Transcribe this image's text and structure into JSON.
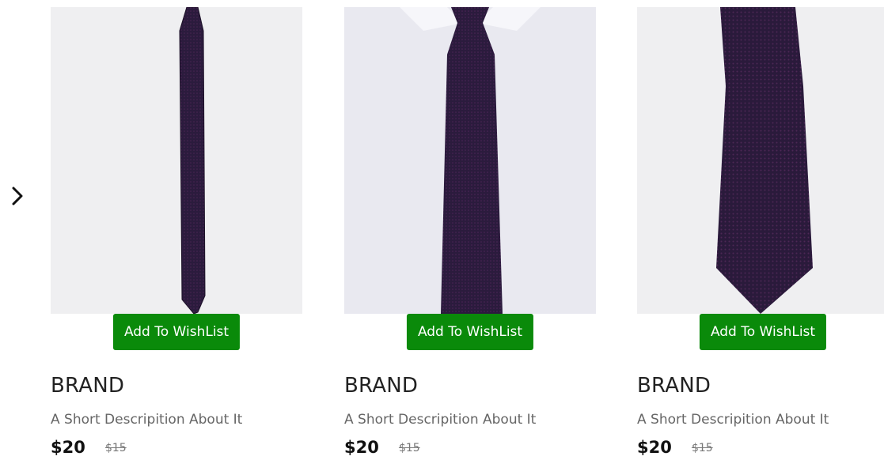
{
  "carousel": {
    "next_icon": "chevron-right-icon"
  },
  "products": [
    {
      "brand": "BRAND",
      "description": "A Short Descripition About It",
      "price": "$20",
      "old_price": "$15",
      "wishlist_label": "Add To WishList",
      "image_bg": "#efeff1",
      "tie_color": "#2b1b3d"
    },
    {
      "brand": "BRAND",
      "description": "A Short Descripition About It",
      "price": "$20",
      "old_price": "$15",
      "wishlist_label": "Add To WishList",
      "image_bg": "#e7e7ee",
      "tie_color": "#2b1b3d"
    },
    {
      "brand": "BRAND",
      "description": "A Short Descripition About It",
      "price": "$20",
      "old_price": "$15",
      "wishlist_label": "Add To WishList",
      "image_bg": "#efeff1",
      "tie_color": "#2b1b3d"
    }
  ],
  "colors": {
    "wishlist_button": "#0a8a0a",
    "brand_text": "#222222",
    "description_text": "#666666"
  }
}
